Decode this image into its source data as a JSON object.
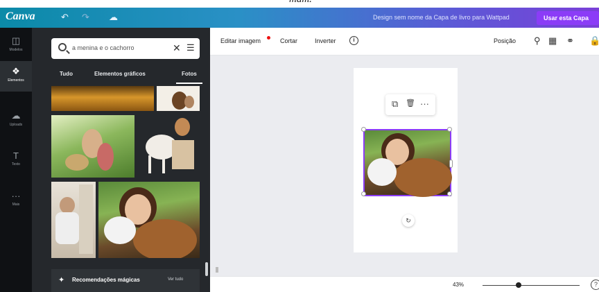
{
  "caption": {
    "text": "mam."
  },
  "topbar": {
    "logo": "Canva",
    "undo_icon": "undo-icon",
    "redo_icon": "redo-icon",
    "cloud_icon": "cloud-icon",
    "design_name": "Design sem nome da Capa de livro para Wattpad",
    "cta": "Usar esta Capa"
  },
  "rail": {
    "items": [
      {
        "icon": "template-icon",
        "glyph": "◫",
        "label": "Modelos"
      },
      {
        "icon": "elements-icon",
        "glyph": "❖",
        "label": "Elementos"
      },
      {
        "icon": "upload-icon",
        "glyph": "☁",
        "label": "Uploads"
      },
      {
        "icon": "text-icon",
        "glyph": "T",
        "label": "Texto"
      },
      {
        "icon": "more-icon",
        "glyph": "···",
        "label": "Mais"
      }
    ]
  },
  "panel": {
    "search": {
      "query": "a menina e o cachorro",
      "clear_glyph": "✕",
      "filter_glyph": "☰"
    },
    "tabs": [
      {
        "label": "Tudo"
      },
      {
        "label": "Elementos gráficos"
      },
      {
        "label": "Fotos"
      }
    ],
    "footer": {
      "label": "Recomendações mágicas",
      "link": "Ver tudo",
      "glyph": "✦"
    }
  },
  "toolbar": {
    "edit_image": "Editar imagem",
    "crop": "Cortar",
    "flip": "Inverter",
    "info_glyph": "i",
    "position": "Posição"
  },
  "canvas": {
    "float_bar": {
      "copy_glyph": "⧉",
      "delete_glyph": "🗑",
      "more_glyph": "···"
    },
    "rotate_glyph": "↻"
  },
  "bottombar": {
    "zoom": "43%",
    "zoom_fraction": 0.43,
    "help_glyph": "?"
  }
}
